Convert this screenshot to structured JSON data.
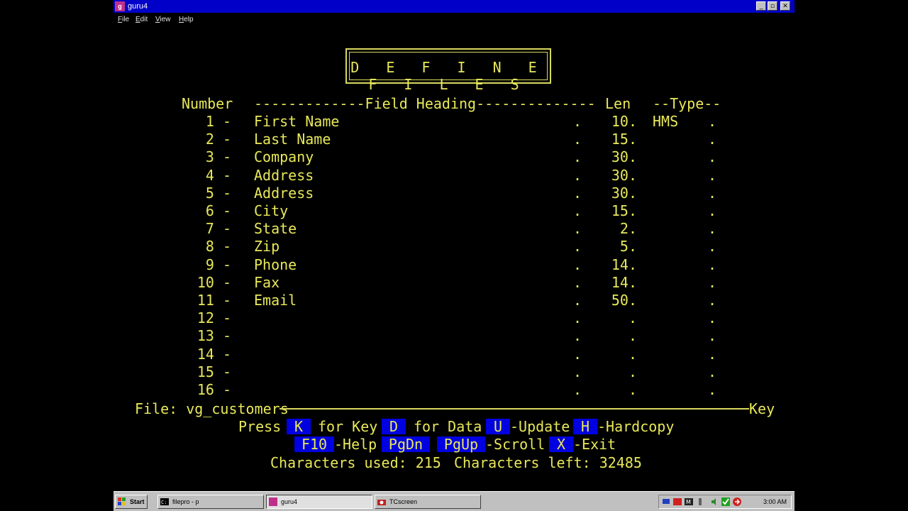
{
  "window": {
    "title": "guru4",
    "app_icon": "guru-app-icon",
    "menu": [
      "File",
      "Edit",
      "View",
      "Help"
    ]
  },
  "screen": {
    "title": "D E F I N E   F I L E S",
    "headers": {
      "number": "Number",
      "heading": "-------------Field Heading--------------",
      "len": "Len",
      "type": "--Type--"
    },
    "rows": [
      {
        "num": "1 -",
        "heading": "First Name",
        "dot": ".",
        "len": "10.",
        "type": "HMS",
        "tdot": "."
      },
      {
        "num": "2 -",
        "heading": "Last Name",
        "dot": ".",
        "len": "15.",
        "type": "",
        "tdot": "."
      },
      {
        "num": "3 -",
        "heading": "Company",
        "dot": ".",
        "len": "30.",
        "type": "",
        "tdot": "."
      },
      {
        "num": "4 -",
        "heading": "Address",
        "dot": ".",
        "len": "30.",
        "type": "",
        "tdot": "."
      },
      {
        "num": "5 -",
        "heading": "Address",
        "dot": ".",
        "len": "30.",
        "type": "",
        "tdot": "."
      },
      {
        "num": "6 -",
        "heading": "City",
        "dot": ".",
        "len": "15.",
        "type": "",
        "tdot": "."
      },
      {
        "num": "7 -",
        "heading": "State",
        "dot": ".",
        "len": "2.",
        "type": "",
        "tdot": "."
      },
      {
        "num": "8 -",
        "heading": "Zip",
        "dot": ".",
        "len": "5.",
        "type": "",
        "tdot": "."
      },
      {
        "num": "9 -",
        "heading": "Phone",
        "dot": ".",
        "len": "14.",
        "type": "",
        "tdot": "."
      },
      {
        "num": "10 -",
        "heading": "Fax",
        "dot": ".",
        "len": "14.",
        "type": "",
        "tdot": "."
      },
      {
        "num": "11 -",
        "heading": "Email",
        "dot": ".",
        "len": "50.",
        "type": "",
        "tdot": "."
      },
      {
        "num": "12 -",
        "heading": "",
        "dot": ".",
        "len": ".",
        "type": "",
        "tdot": "."
      },
      {
        "num": "13 -",
        "heading": "",
        "dot": ".",
        "len": ".",
        "type": "",
        "tdot": "."
      },
      {
        "num": "14 -",
        "heading": "",
        "dot": ".",
        "len": ".",
        "type": "",
        "tdot": "."
      },
      {
        "num": "15 -",
        "heading": "",
        "dot": ".",
        "len": ".",
        "type": "",
        "tdot": "."
      },
      {
        "num": "16 -",
        "heading": "",
        "dot": ".",
        "len": ".",
        "type": "",
        "tdot": "."
      }
    ],
    "file_label": "File: vg_customers",
    "key_label": "Key",
    "commands_line1": {
      "press": "Press",
      "k_key": "K",
      "k_text": "for Key",
      "d_key": "D",
      "d_text": "for Data",
      "u_key": "U",
      "u_text": "-Update",
      "h_key": "H",
      "h_text": "-Hardcopy"
    },
    "commands_line2": {
      "f10_key": "F10",
      "f10_text": "-Help",
      "pgdn_key": "PgDn",
      "pgup_key": "PgUp",
      "scroll_text": "-Scroll",
      "x_key": "X",
      "x_text": "-Exit"
    },
    "status": {
      "used": "Characters used: 215",
      "left": "Characters left: 32485"
    }
  },
  "taskbar": {
    "start_label": "Start",
    "tasks": [
      {
        "label": "filepro - p",
        "icon": "terminal-icon"
      },
      {
        "label": "guru4",
        "icon": "guru-app-icon"
      },
      {
        "label": "TCscreen",
        "icon": "camera-icon"
      }
    ],
    "clock": "3:00 AM"
  },
  "colors": {
    "text": "#e8e85a",
    "highlight_bg": "#0000e0",
    "titlebar": "#0000c8"
  }
}
